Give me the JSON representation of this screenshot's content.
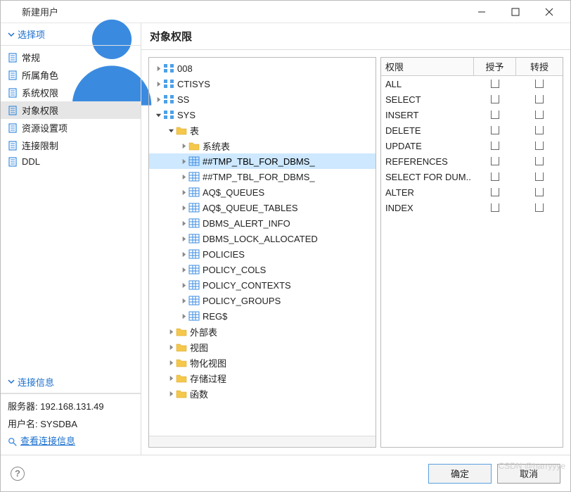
{
  "window": {
    "title": "新建用户"
  },
  "sidebar": {
    "header": "选择项",
    "items": [
      {
        "label": "常规"
      },
      {
        "label": "所属角色"
      },
      {
        "label": "系统权限"
      },
      {
        "label": "对象权限"
      },
      {
        "label": "资源设置项"
      },
      {
        "label": "连接限制"
      },
      {
        "label": "DDL"
      }
    ],
    "conn_header": "连接信息",
    "server_label": "服务器:",
    "server_value": "192.168.131.49",
    "user_label": "用户名:",
    "user_value": "SYSDBA",
    "view_link": "查看连接信息"
  },
  "main": {
    "title": "对象权限",
    "tree": [
      {
        "label": "008",
        "depth": 1,
        "exp": false,
        "icon": "schema"
      },
      {
        "label": "CTISYS",
        "depth": 1,
        "exp": false,
        "icon": "schema"
      },
      {
        "label": "SS",
        "depth": 1,
        "exp": false,
        "icon": "schema"
      },
      {
        "label": "SYS",
        "depth": 1,
        "exp": true,
        "icon": "schema"
      },
      {
        "label": "表",
        "depth": 2,
        "exp": true,
        "icon": "folder"
      },
      {
        "label": "系统表",
        "depth": 3,
        "exp": false,
        "icon": "folder"
      },
      {
        "label": "##TMP_TBL_FOR_DBMS_",
        "depth": 3,
        "exp": false,
        "icon": "table",
        "sel": true
      },
      {
        "label": "##TMP_TBL_FOR_DBMS_",
        "depth": 3,
        "exp": false,
        "icon": "table"
      },
      {
        "label": "AQ$_QUEUES",
        "depth": 3,
        "exp": false,
        "icon": "table"
      },
      {
        "label": "AQ$_QUEUE_TABLES",
        "depth": 3,
        "exp": false,
        "icon": "table"
      },
      {
        "label": "DBMS_ALERT_INFO",
        "depth": 3,
        "exp": false,
        "icon": "table"
      },
      {
        "label": "DBMS_LOCK_ALLOCATED",
        "depth": 3,
        "exp": false,
        "icon": "table"
      },
      {
        "label": "POLICIES",
        "depth": 3,
        "exp": false,
        "icon": "table"
      },
      {
        "label": "POLICY_COLS",
        "depth": 3,
        "exp": false,
        "icon": "table"
      },
      {
        "label": "POLICY_CONTEXTS",
        "depth": 3,
        "exp": false,
        "icon": "table"
      },
      {
        "label": "POLICY_GROUPS",
        "depth": 3,
        "exp": false,
        "icon": "table"
      },
      {
        "label": "REG$",
        "depth": 3,
        "exp": false,
        "icon": "table"
      },
      {
        "label": "外部表",
        "depth": 2,
        "exp": false,
        "icon": "folder"
      },
      {
        "label": "视图",
        "depth": 2,
        "exp": false,
        "icon": "folder"
      },
      {
        "label": "物化视图",
        "depth": 2,
        "exp": false,
        "icon": "folder"
      },
      {
        "label": "存储过程",
        "depth": 2,
        "exp": false,
        "icon": "folder"
      },
      {
        "label": "函数",
        "depth": 2,
        "exp": false,
        "icon": "folder"
      }
    ],
    "grid": {
      "headers": {
        "perm": "权限",
        "grant": "授予",
        "transfer": "转授"
      },
      "rows": [
        {
          "perm": "ALL"
        },
        {
          "perm": "SELECT"
        },
        {
          "perm": "INSERT"
        },
        {
          "perm": "DELETE"
        },
        {
          "perm": "UPDATE"
        },
        {
          "perm": "REFERENCES"
        },
        {
          "perm": "SELECT FOR DUM.."
        },
        {
          "perm": "ALTER"
        },
        {
          "perm": "INDEX"
        }
      ]
    }
  },
  "footer": {
    "ok": "确定",
    "cancel": "取消"
  },
  "watermark": "CSDN @harryyye"
}
